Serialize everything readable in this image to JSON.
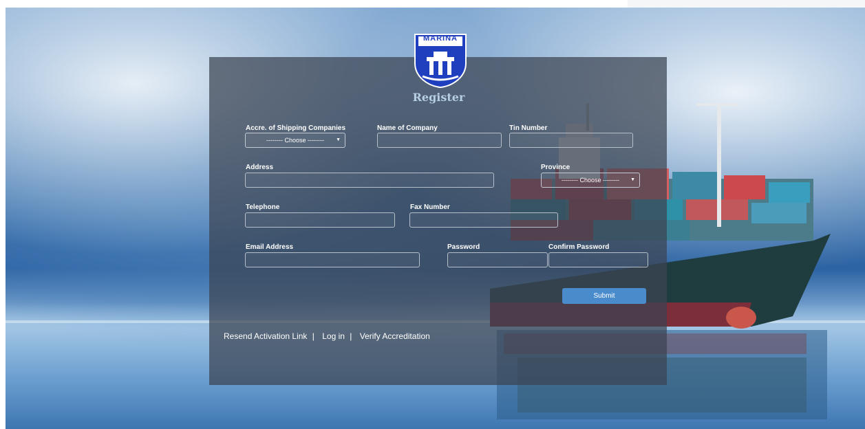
{
  "header": {
    "logo_text": "MARINA",
    "title": "Register"
  },
  "form": {
    "accreditation": {
      "label": "Accre. of Shipping Companies",
      "value": "-------- Choose --------"
    },
    "company_name": {
      "label": "Name of Company",
      "value": ""
    },
    "tin_number": {
      "label": "Tin Number",
      "value": ""
    },
    "address": {
      "label": "Address",
      "value": ""
    },
    "province": {
      "label": "Province",
      "value": "-------- Choose --------"
    },
    "telephone": {
      "label": "Telephone",
      "value": ""
    },
    "fax_number": {
      "label": "Fax Number",
      "value": ""
    },
    "email": {
      "label": "Email Address",
      "value": ""
    },
    "password": {
      "label": "Password",
      "value": ""
    },
    "confirm_password": {
      "label": "Confirm Password",
      "value": ""
    },
    "submit_label": "Submit"
  },
  "footer": {
    "resend_label": "Resend Activation Link",
    "login_label": "Log in",
    "verify_label": "Verify Accreditation",
    "separator": "|"
  },
  "colors": {
    "panel": "#3c4452",
    "submit": "#4a8bcc",
    "title": "#b6cfe4",
    "logo": "#1f3fbf"
  }
}
